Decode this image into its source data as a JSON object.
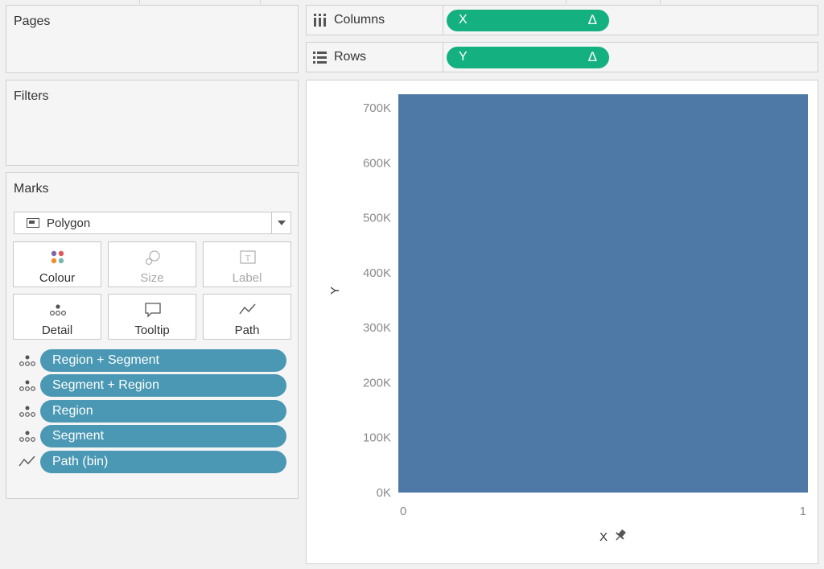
{
  "cards": {
    "pages_title": "Pages",
    "filters_title": "Filters",
    "marks_title": "Marks"
  },
  "marks": {
    "mark_type": "Polygon",
    "buttons": [
      {
        "label": "Colour",
        "icon": "colour-icon",
        "enabled": true
      },
      {
        "label": "Size",
        "icon": "size-icon",
        "enabled": false
      },
      {
        "label": "Label",
        "icon": "label-icon",
        "enabled": false
      },
      {
        "label": "Detail",
        "icon": "detail-icon",
        "enabled": true
      },
      {
        "label": "Tooltip",
        "icon": "tooltip-icon",
        "enabled": true
      },
      {
        "label": "Path",
        "icon": "path-icon",
        "enabled": true
      }
    ],
    "fields": [
      {
        "label": "Region + Segment",
        "icon": "detail-icon"
      },
      {
        "label": "Segment + Region",
        "icon": "detail-icon"
      },
      {
        "label": "Region",
        "icon": "detail-icon"
      },
      {
        "label": "Segment",
        "icon": "detail-icon"
      },
      {
        "label": "Path (bin)",
        "icon": "path-icon"
      }
    ]
  },
  "shelves": {
    "columns": {
      "name": "Columns",
      "pill": "X",
      "delta": "Δ"
    },
    "rows": {
      "name": "Rows",
      "pill": "Y",
      "delta": "Δ"
    }
  },
  "colors": {
    "bar": "#4e79a7",
    "field_pill": "#4a98b3",
    "shelf_pill": "#15b080"
  },
  "chart_data": {
    "type": "area",
    "x": [
      0,
      1
    ],
    "y": [
      725000,
      725000
    ],
    "xlabel": "X",
    "ylabel": "Y",
    "xlim": [
      0,
      1
    ],
    "ylim": [
      0,
      750000
    ],
    "y_ticks": [
      "0K",
      "100K",
      "200K",
      "300K",
      "400K",
      "500K",
      "600K",
      "700K"
    ],
    "x_ticks": [
      "0",
      "1"
    ],
    "grid": false
  }
}
